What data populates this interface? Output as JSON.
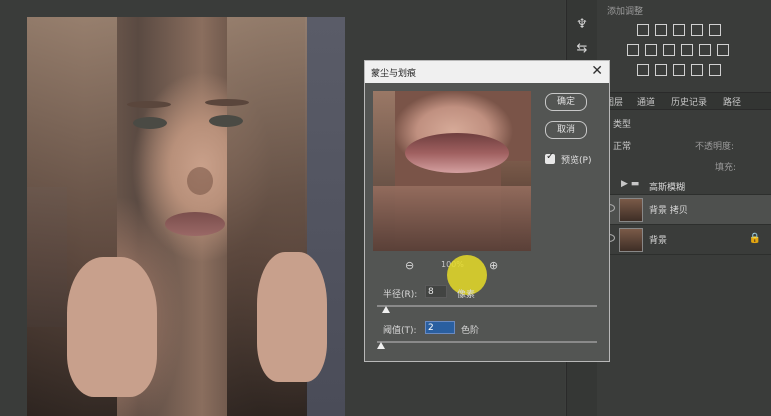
{
  "dialog": {
    "title": "蒙尘与划痕",
    "ok_label": "确定",
    "cancel_label": "取消",
    "preview_label": "预览(P)",
    "zoom_percent": "100%",
    "radius_label": "半径(R):",
    "radius_value": "8",
    "radius_unit": "像素",
    "threshold_label": "阈值(T):",
    "threshold_value": "2",
    "threshold_unit": "色阶"
  },
  "panel": {
    "adjust_title": "添加调整",
    "tabs": [
      "图层",
      "通道",
      "历史记录",
      "路径"
    ],
    "kind_label": "类型",
    "mode_label": "正常",
    "opacity_label": "不透明度:",
    "fill_label": "填充:",
    "layers": [
      "高斯模糊",
      "背景 拷贝",
      "背景"
    ]
  },
  "icons": [
    "zoom-out-icon",
    "zoom-in-icon",
    "close-icon",
    "eye-icon",
    "lock-icon",
    "folder-icon",
    "checkmark-icon"
  ]
}
